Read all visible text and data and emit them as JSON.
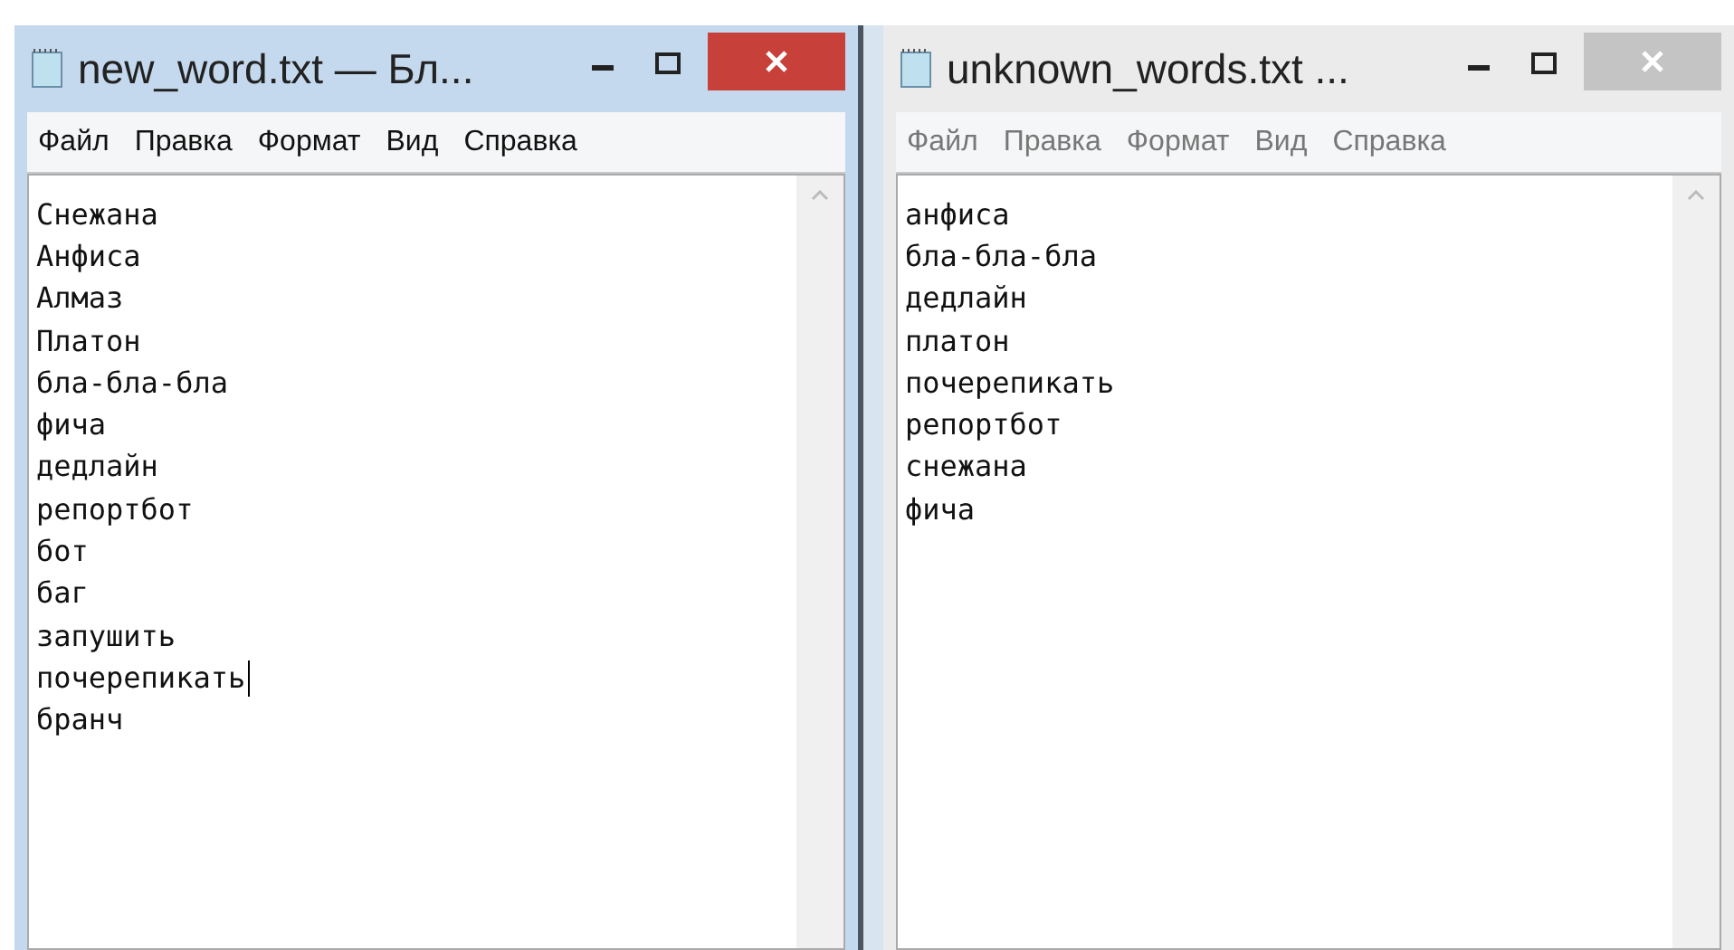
{
  "windows": [
    {
      "title": "new_word.txt — Бл...",
      "active": true,
      "menu": [
        "Файл",
        "Правка",
        "Формат",
        "Вид",
        "Справка"
      ],
      "lines": [
        {
          "text": "Снежана",
          "caret": false
        },
        {
          "text": "Анфиса",
          "caret": false
        },
        {
          "text": "Алмаз",
          "caret": false
        },
        {
          "text": "Платон",
          "caret": false
        },
        {
          "text": "бла-бла-бла",
          "caret": false
        },
        {
          "text": "фича",
          "caret": false
        },
        {
          "text": "дедлайн",
          "caret": false
        },
        {
          "text": "репортбот",
          "caret": false
        },
        {
          "text": "бот",
          "caret": false
        },
        {
          "text": "баг",
          "caret": false
        },
        {
          "text": "запушить",
          "caret": false
        },
        {
          "text": "почерепикать",
          "caret": true
        },
        {
          "text": "бранч",
          "caret": false
        }
      ]
    },
    {
      "title": "unknown_words.txt ...",
      "active": false,
      "menu": [
        "Файл",
        "Правка",
        "Формат",
        "Вид",
        "Справка"
      ],
      "lines": [
        {
          "text": "анфиса",
          "caret": false
        },
        {
          "text": "бла-бла-бла",
          "caret": false
        },
        {
          "text": "дедлайн",
          "caret": false
        },
        {
          "text": "платон",
          "caret": false
        },
        {
          "text": "почерепикать",
          "caret": false
        },
        {
          "text": "репортбот",
          "caret": false
        },
        {
          "text": "снежана",
          "caret": false
        },
        {
          "text": "фича",
          "caret": false
        }
      ]
    }
  ]
}
